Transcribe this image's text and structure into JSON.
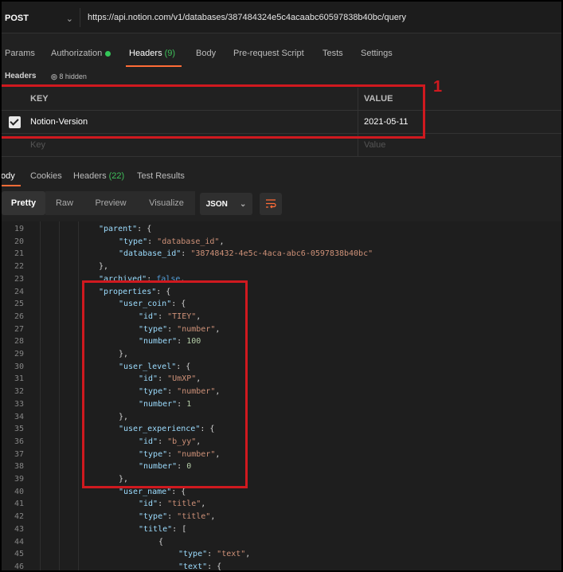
{
  "request": {
    "method": "POST",
    "url": "https://api.notion.com/v1/databases/387484324e5c4acaabc60597838b40bc/query"
  },
  "request_tabs": [
    {
      "label": "Params"
    },
    {
      "label": "Authorization"
    },
    {
      "label": "Headers",
      "count": "(9)"
    },
    {
      "label": "Body"
    },
    {
      "label": "Pre-request Script"
    },
    {
      "label": "Tests"
    },
    {
      "label": "Settings"
    }
  ],
  "headers_section": {
    "label": "Headers",
    "hidden": "8 hidden"
  },
  "headers_table": {
    "col_key": "KEY",
    "col_value": "VALUE",
    "rows": [
      {
        "key": "Notion-Version",
        "value": "2021-05-11",
        "checked": true
      }
    ],
    "placeholder_key": "Key",
    "placeholder_value": "Value"
  },
  "annotation_number": "1",
  "response_tabs": [
    {
      "label": "ody"
    },
    {
      "label": "Cookies"
    },
    {
      "label": "Headers",
      "count": "(22)"
    },
    {
      "label": "Test Results"
    }
  ],
  "view_modes": [
    "Pretty",
    "Raw",
    "Preview",
    "Visualize"
  ],
  "format": "JSON",
  "icons": {
    "format_chevron": "chevron-down-icon",
    "wrap": "wrap-lines-icon",
    "check": "checkbox-checked-icon"
  },
  "colors": {
    "accent": "#ff6c37",
    "annotation": "#d0191f",
    "auth_dot": "#34c759"
  },
  "code_lines": [
    {
      "n": "19",
      "t": "            \"parent\": {"
    },
    {
      "n": "20",
      "t": "                \"type\": \"database_id\","
    },
    {
      "n": "21",
      "t": "                \"database_id\": \"38748432-4e5c-4aca-abc6-0597838b40bc\""
    },
    {
      "n": "22",
      "t": "            },"
    },
    {
      "n": "23",
      "t": "            \"archived\": false,"
    },
    {
      "n": "24",
      "t": "            \"properties\": {"
    },
    {
      "n": "25",
      "t": "                \"user_coin\": {"
    },
    {
      "n": "26",
      "t": "                    \"id\": \"TIEY\","
    },
    {
      "n": "27",
      "t": "                    \"type\": \"number\","
    },
    {
      "n": "28",
      "t": "                    \"number\": 100"
    },
    {
      "n": "29",
      "t": "                },"
    },
    {
      "n": "30",
      "t": "                \"user_level\": {"
    },
    {
      "n": "31",
      "t": "                    \"id\": \"UmXP\","
    },
    {
      "n": "32",
      "t": "                    \"type\": \"number\","
    },
    {
      "n": "33",
      "t": "                    \"number\": 1"
    },
    {
      "n": "34",
      "t": "                },"
    },
    {
      "n": "35",
      "t": "                \"user_experience\": {"
    },
    {
      "n": "36",
      "t": "                    \"id\": \"b_yy\","
    },
    {
      "n": "37",
      "t": "                    \"type\": \"number\","
    },
    {
      "n": "38",
      "t": "                    \"number\": 0"
    },
    {
      "n": "39",
      "t": "                },"
    },
    {
      "n": "40",
      "t": "                \"user_name\": {"
    },
    {
      "n": "41",
      "t": "                    \"id\": \"title\","
    },
    {
      "n": "42",
      "t": "                    \"type\": \"title\","
    },
    {
      "n": "43",
      "t": "                    \"title\": ["
    },
    {
      "n": "44",
      "t": "                        {"
    },
    {
      "n": "45",
      "t": "                            \"type\": \"text\","
    },
    {
      "n": "46",
      "t": "                            \"text\": {"
    }
  ]
}
